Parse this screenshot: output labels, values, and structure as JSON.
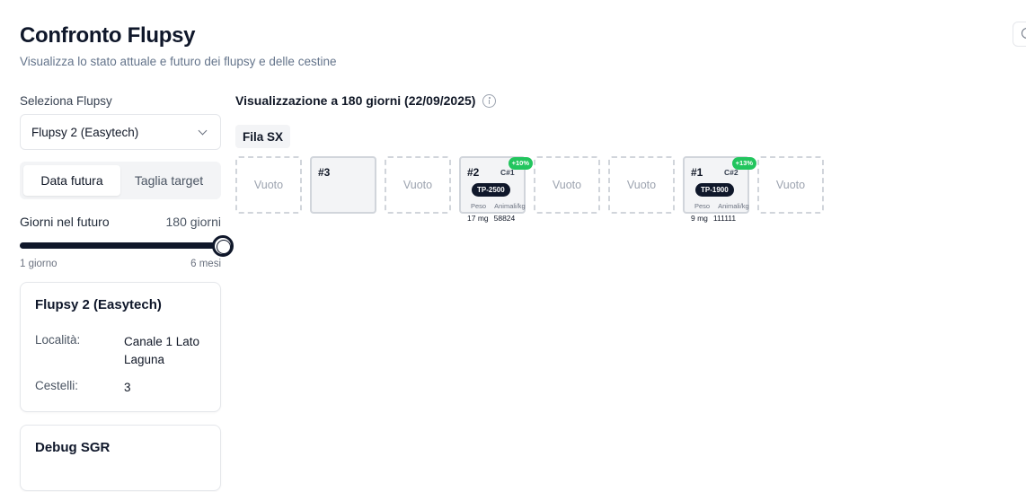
{
  "header": {
    "title": "Confronto Flupsy",
    "subtitle": "Visualizza lo stato attuale e futuro dei flupsy e delle cestine"
  },
  "sidebar": {
    "select_label": "Seleziona Flupsy",
    "selected_flupsy": "Flupsy 2 (Easytech)",
    "tabs": [
      {
        "label": "Data futura",
        "active": true
      },
      {
        "label": "Taglia target",
        "active": false
      }
    ],
    "slider": {
      "label": "Giorni nel futuro",
      "value_text": "180 giorni",
      "value_fraction": 1.0,
      "min_label": "1 giorno",
      "max_label": "6 mesi"
    },
    "info_card": {
      "title": "Flupsy 2 (Easytech)",
      "rows": [
        {
          "key": "Località:",
          "value": "Canale 1 Lato Laguna"
        },
        {
          "key": "Cestelli:",
          "value": "3"
        }
      ]
    },
    "debug_card": {
      "title": "Debug SGR"
    }
  },
  "main": {
    "title": "Visualizzazione a 180 giorni (22/09/2025)",
    "row_label": "Fila SX",
    "empty_label": "Vuoto",
    "stat_labels": {
      "weight": "Peso",
      "density": "Animali/kg"
    },
    "slots": [
      {
        "type": "empty"
      },
      {
        "type": "filled",
        "number": "#3"
      },
      {
        "type": "empty"
      },
      {
        "type": "filled",
        "number": "#2",
        "code": "C#1",
        "growth": "+10%",
        "size": "TP-2500",
        "weight": "17 mg",
        "density": "58824"
      },
      {
        "type": "empty"
      },
      {
        "type": "empty"
      },
      {
        "type": "filled",
        "number": "#1",
        "code": "C#2",
        "growth": "+13%",
        "size": "TP-1900",
        "weight": "9 mg",
        "density": "111111"
      },
      {
        "type": "empty"
      }
    ]
  },
  "colors": {
    "accent": "#0f172a",
    "growth_badge": "#22c55e",
    "border": "#e5e7eb"
  }
}
